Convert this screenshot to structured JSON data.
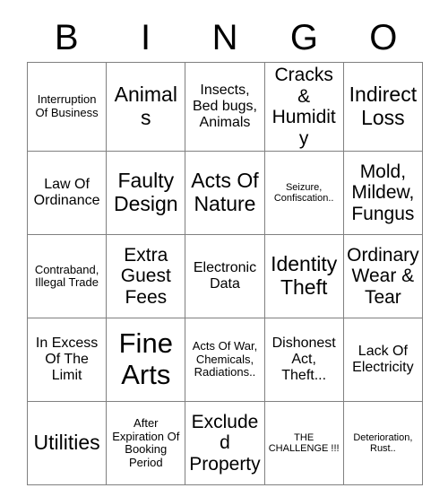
{
  "header": {
    "letters": [
      "B",
      "I",
      "N",
      "G",
      "O"
    ]
  },
  "grid": {
    "rows": [
      [
        {
          "text": "Interruption Of Business",
          "size": "fs-s"
        },
        {
          "text": "Animals",
          "size": "fs-xl"
        },
        {
          "text": "Insects, Bed bugs, Animals",
          "size": "fs-m"
        },
        {
          "text": "Cracks & Humidity",
          "size": "fs-l"
        },
        {
          "text": "Indirect Loss",
          "size": "fs-xl"
        }
      ],
      [
        {
          "text": "Law Of Ordinance",
          "size": "fs-m"
        },
        {
          "text": "Faulty Design",
          "size": "fs-xl"
        },
        {
          "text": "Acts Of Nature",
          "size": "fs-xl"
        },
        {
          "text": "Seizure, Confiscation..",
          "size": "fs-xs"
        },
        {
          "text": "Mold, Mildew, Fungus",
          "size": "fs-l"
        }
      ],
      [
        {
          "text": "Contraband, Illegal Trade",
          "size": "fs-s"
        },
        {
          "text": "Extra Guest Fees",
          "size": "fs-l"
        },
        {
          "text": "Electronic Data",
          "size": "fs-m"
        },
        {
          "text": "Identity Theft",
          "size": "fs-xl"
        },
        {
          "text": "Ordinary Wear & Tear",
          "size": "fs-l"
        }
      ],
      [
        {
          "text": "In Excess Of The Limit",
          "size": "fs-m"
        },
        {
          "text": "Fine Arts",
          "size": "fs-xxl"
        },
        {
          "text": "Acts Of War, Chemicals, Radiations..",
          "size": "fs-s"
        },
        {
          "text": "Dishonest Act, Theft...",
          "size": "fs-m"
        },
        {
          "text": "Lack Of Electricity",
          "size": "fs-m"
        }
      ],
      [
        {
          "text": "Utilities",
          "size": "fs-xl"
        },
        {
          "text": "After Expiration Of Booking Period",
          "size": "fs-s"
        },
        {
          "text": "Excluded Property",
          "size": "fs-l"
        },
        {
          "text": "THE CHALLENGE !!!",
          "size": "fs-xs"
        },
        {
          "text": "Deterioration, Rust..",
          "size": "fs-xs"
        }
      ]
    ]
  }
}
